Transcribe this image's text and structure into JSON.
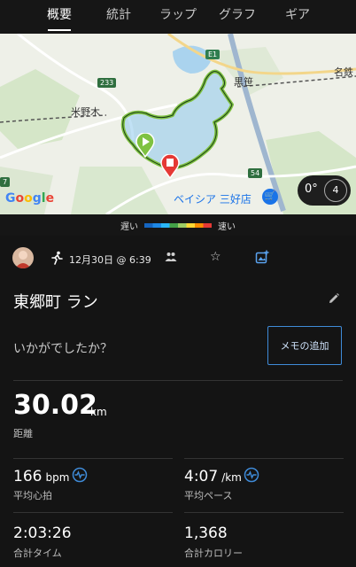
{
  "tabs": [
    {
      "label": "概要",
      "active": true
    },
    {
      "label": "統計",
      "active": false
    },
    {
      "label": "ラップ",
      "active": false
    },
    {
      "label": "グラフ",
      "active": false
    },
    {
      "label": "ギア",
      "active": false
    }
  ],
  "map": {
    "labels": {
      "yoneno": "米野木",
      "kurozasa": "黒笹",
      "meitetsu": "名鉄",
      "store": "ベイシア 三好店",
      "google": "Google"
    },
    "road_numbers": {
      "r233": "233",
      "r54": "54",
      "e1": "E1",
      "r7": "7"
    },
    "weather": {
      "temp": "0°",
      "wind": "4"
    },
    "icons": [
      "start-pin-icon",
      "finish-pin-icon",
      "shopping-cart-icon",
      "wind-icon"
    ]
  },
  "legend": {
    "slow": "遅い",
    "fast": "速い",
    "colors": [
      "#1565c0",
      "#1e88e5",
      "#29b6f6",
      "#43a047",
      "#9ccc65",
      "#fdd835",
      "#fb8c00",
      "#e53935"
    ]
  },
  "activity": {
    "date": "12月30日 @ 6:39",
    "title": "東郷町 ラン",
    "prompt": "いかがでしたか？",
    "memo_button": "メモの追加"
  },
  "stats": {
    "distance": {
      "value": "30.02",
      "unit": "km",
      "label": "距離"
    },
    "heart_rate": {
      "value": "166",
      "unit": "bpm",
      "label": "平均心拍"
    },
    "pace": {
      "value": "4:07",
      "unit": "/km",
      "label": "平均ペース"
    },
    "time": {
      "value": "2:03:26",
      "label": "合計タイム"
    },
    "calories": {
      "value": "1,368",
      "label": "合計カロリー"
    }
  },
  "colors": {
    "accent": "#3f8bd8",
    "background": "#141414",
    "route": "#7fc241",
    "finish": "#e53935"
  }
}
